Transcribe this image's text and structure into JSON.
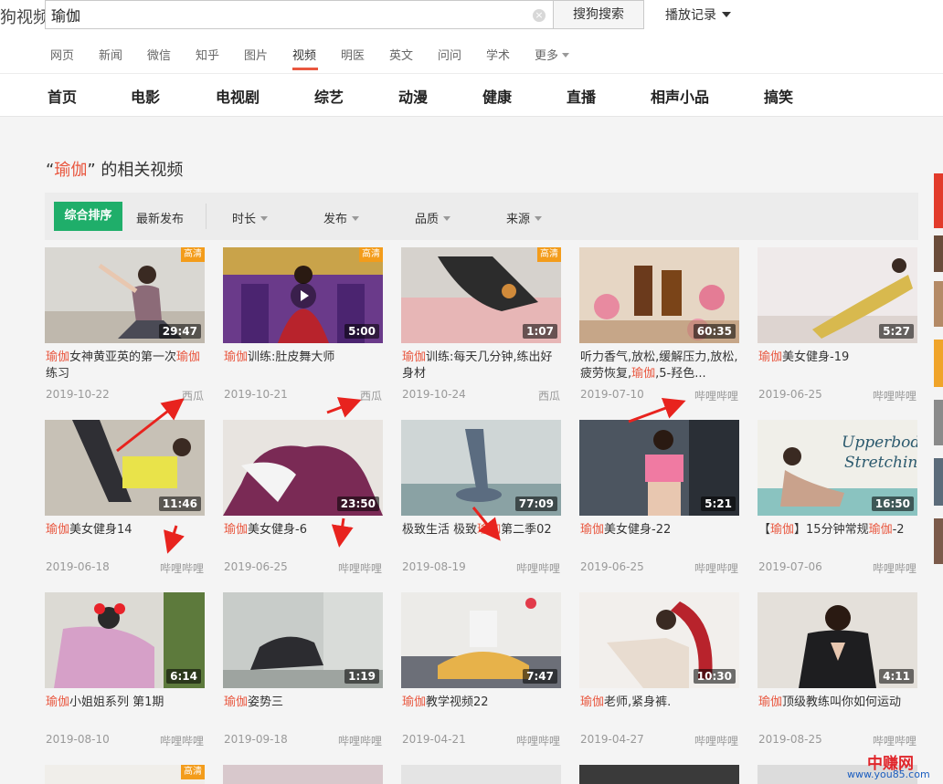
{
  "header": {
    "logo_text": "狗视频",
    "search_value": "瑜伽",
    "search_button": "搜狗搜索",
    "history_label": "播放记录"
  },
  "channel_tabs": [
    {
      "label": "网页"
    },
    {
      "label": "新闻"
    },
    {
      "label": "微信"
    },
    {
      "label": "知乎"
    },
    {
      "label": "图片"
    },
    {
      "label": "视频",
      "active": true
    },
    {
      "label": "明医"
    },
    {
      "label": "英文"
    },
    {
      "label": "问问"
    },
    {
      "label": "学术"
    },
    {
      "label": "更多"
    }
  ],
  "categories": [
    "首页",
    "电影",
    "电视剧",
    "综艺",
    "动漫",
    "健康",
    "直播",
    "相声小品",
    "搞笑"
  ],
  "results": {
    "keyword": "瑜伽",
    "quote_open": "“",
    "quote_close": "”",
    "suffix": "的相关视频"
  },
  "filters": {
    "sort_active": "综合排序",
    "sort_new": "最新发布",
    "items": [
      "时长",
      "发布",
      "品质",
      "来源"
    ]
  },
  "hd_label": "高清",
  "videos": [
    {
      "title_parts": [
        {
          "t": "瑜伽",
          "h": true
        },
        {
          "t": "女神黄亚英的第一次"
        },
        {
          "t": "瑜伽",
          "h": true
        },
        {
          "t": "练习"
        }
      ],
      "duration": "29:47",
      "date": "2019-10-22",
      "source": "西瓜",
      "hd": true
    },
    {
      "title_parts": [
        {
          "t": "瑜伽",
          "h": true
        },
        {
          "t": "训练:肚皮舞大师"
        }
      ],
      "duration": "5:00",
      "date": "2019-10-21",
      "source": "西瓜",
      "hd": true,
      "play": true
    },
    {
      "title_parts": [
        {
          "t": "瑜伽",
          "h": true
        },
        {
          "t": "训练:每天几分钟,练出好身材"
        }
      ],
      "duration": "1:07",
      "date": "2019-10-24",
      "source": "西瓜",
      "hd": true
    },
    {
      "title_parts": [
        {
          "t": "听力香气,放松,缓解压力,放松,疲劳恢复,"
        },
        {
          "t": "瑜伽",
          "h": true
        },
        {
          "t": ",5-羟色..."
        }
      ],
      "duration": "60:35",
      "date": "2019-07-10",
      "source": "哔哩哔哩"
    },
    {
      "title_parts": [
        {
          "t": "瑜伽",
          "h": true
        },
        {
          "t": "美女健身-19"
        }
      ],
      "duration": "5:27",
      "date": "2019-06-25",
      "source": "哔哩哔哩"
    },
    {
      "title_parts": [
        {
          "t": "瑜伽",
          "h": true
        },
        {
          "t": "美女健身14"
        }
      ],
      "duration": "11:46",
      "date": "2019-06-18",
      "source": "哔哩哔哩"
    },
    {
      "title_parts": [
        {
          "t": "瑜伽",
          "h": true
        },
        {
          "t": "美女健身-6"
        }
      ],
      "duration": "23:50",
      "date": "2019-06-25",
      "source": "哔哩哔哩"
    },
    {
      "title_parts": [
        {
          "t": "极致生活 极致"
        },
        {
          "t": "瑜伽",
          "h": true
        },
        {
          "t": "第二季02"
        }
      ],
      "duration": "77:09",
      "date": "2019-08-19",
      "source": "哔哩哔哩"
    },
    {
      "title_parts": [
        {
          "t": "瑜伽",
          "h": true
        },
        {
          "t": "美女健身-22"
        }
      ],
      "duration": "5:21",
      "date": "2019-06-25",
      "source": "哔哩哔哩"
    },
    {
      "title_parts": [
        {
          "t": "【"
        },
        {
          "t": "瑜伽",
          "h": true
        },
        {
          "t": "】15分钟常规"
        },
        {
          "t": "瑜伽",
          "h": true
        },
        {
          "t": "-2"
        }
      ],
      "duration": "16:50",
      "date": "2019-07-06",
      "source": "哔哩哔哩",
      "thumb_text": "Upperbody Stretching"
    },
    {
      "title_parts": [
        {
          "t": "瑜伽",
          "h": true
        },
        {
          "t": "小姐姐系列 第1期"
        }
      ],
      "duration": "6:14",
      "date": "2019-08-10",
      "source": "哔哩哔哩"
    },
    {
      "title_parts": [
        {
          "t": "瑜伽",
          "h": true
        },
        {
          "t": "姿势三"
        }
      ],
      "duration": "1:19",
      "date": "2019-09-18",
      "source": "哔哩哔哩"
    },
    {
      "title_parts": [
        {
          "t": "瑜伽",
          "h": true
        },
        {
          "t": "教学视频22"
        }
      ],
      "duration": "7:47",
      "date": "2019-04-21",
      "source": "哔哩哔哩"
    },
    {
      "title_parts": [
        {
          "t": "瑜伽",
          "h": true
        },
        {
          "t": "老师,紧身裤."
        }
      ],
      "duration": "10:30",
      "date": "2019-04-27",
      "source": "哔哩哔哩"
    },
    {
      "title_parts": [
        {
          "t": "瑜伽",
          "h": true
        },
        {
          "t": "顶级教练叫你如何运动"
        }
      ],
      "duration": "4:11",
      "date": "2019-08-25",
      "source": "哔哩哔哩"
    }
  ],
  "peek_row": [
    {
      "hd": true
    },
    {},
    {},
    {},
    {}
  ],
  "watermark": {
    "main": "中赚网",
    "url": "www.you85.com"
  },
  "colors": {
    "accent": "#e9573f",
    "green": "#1fae6a",
    "hd": "#f39c1b"
  }
}
